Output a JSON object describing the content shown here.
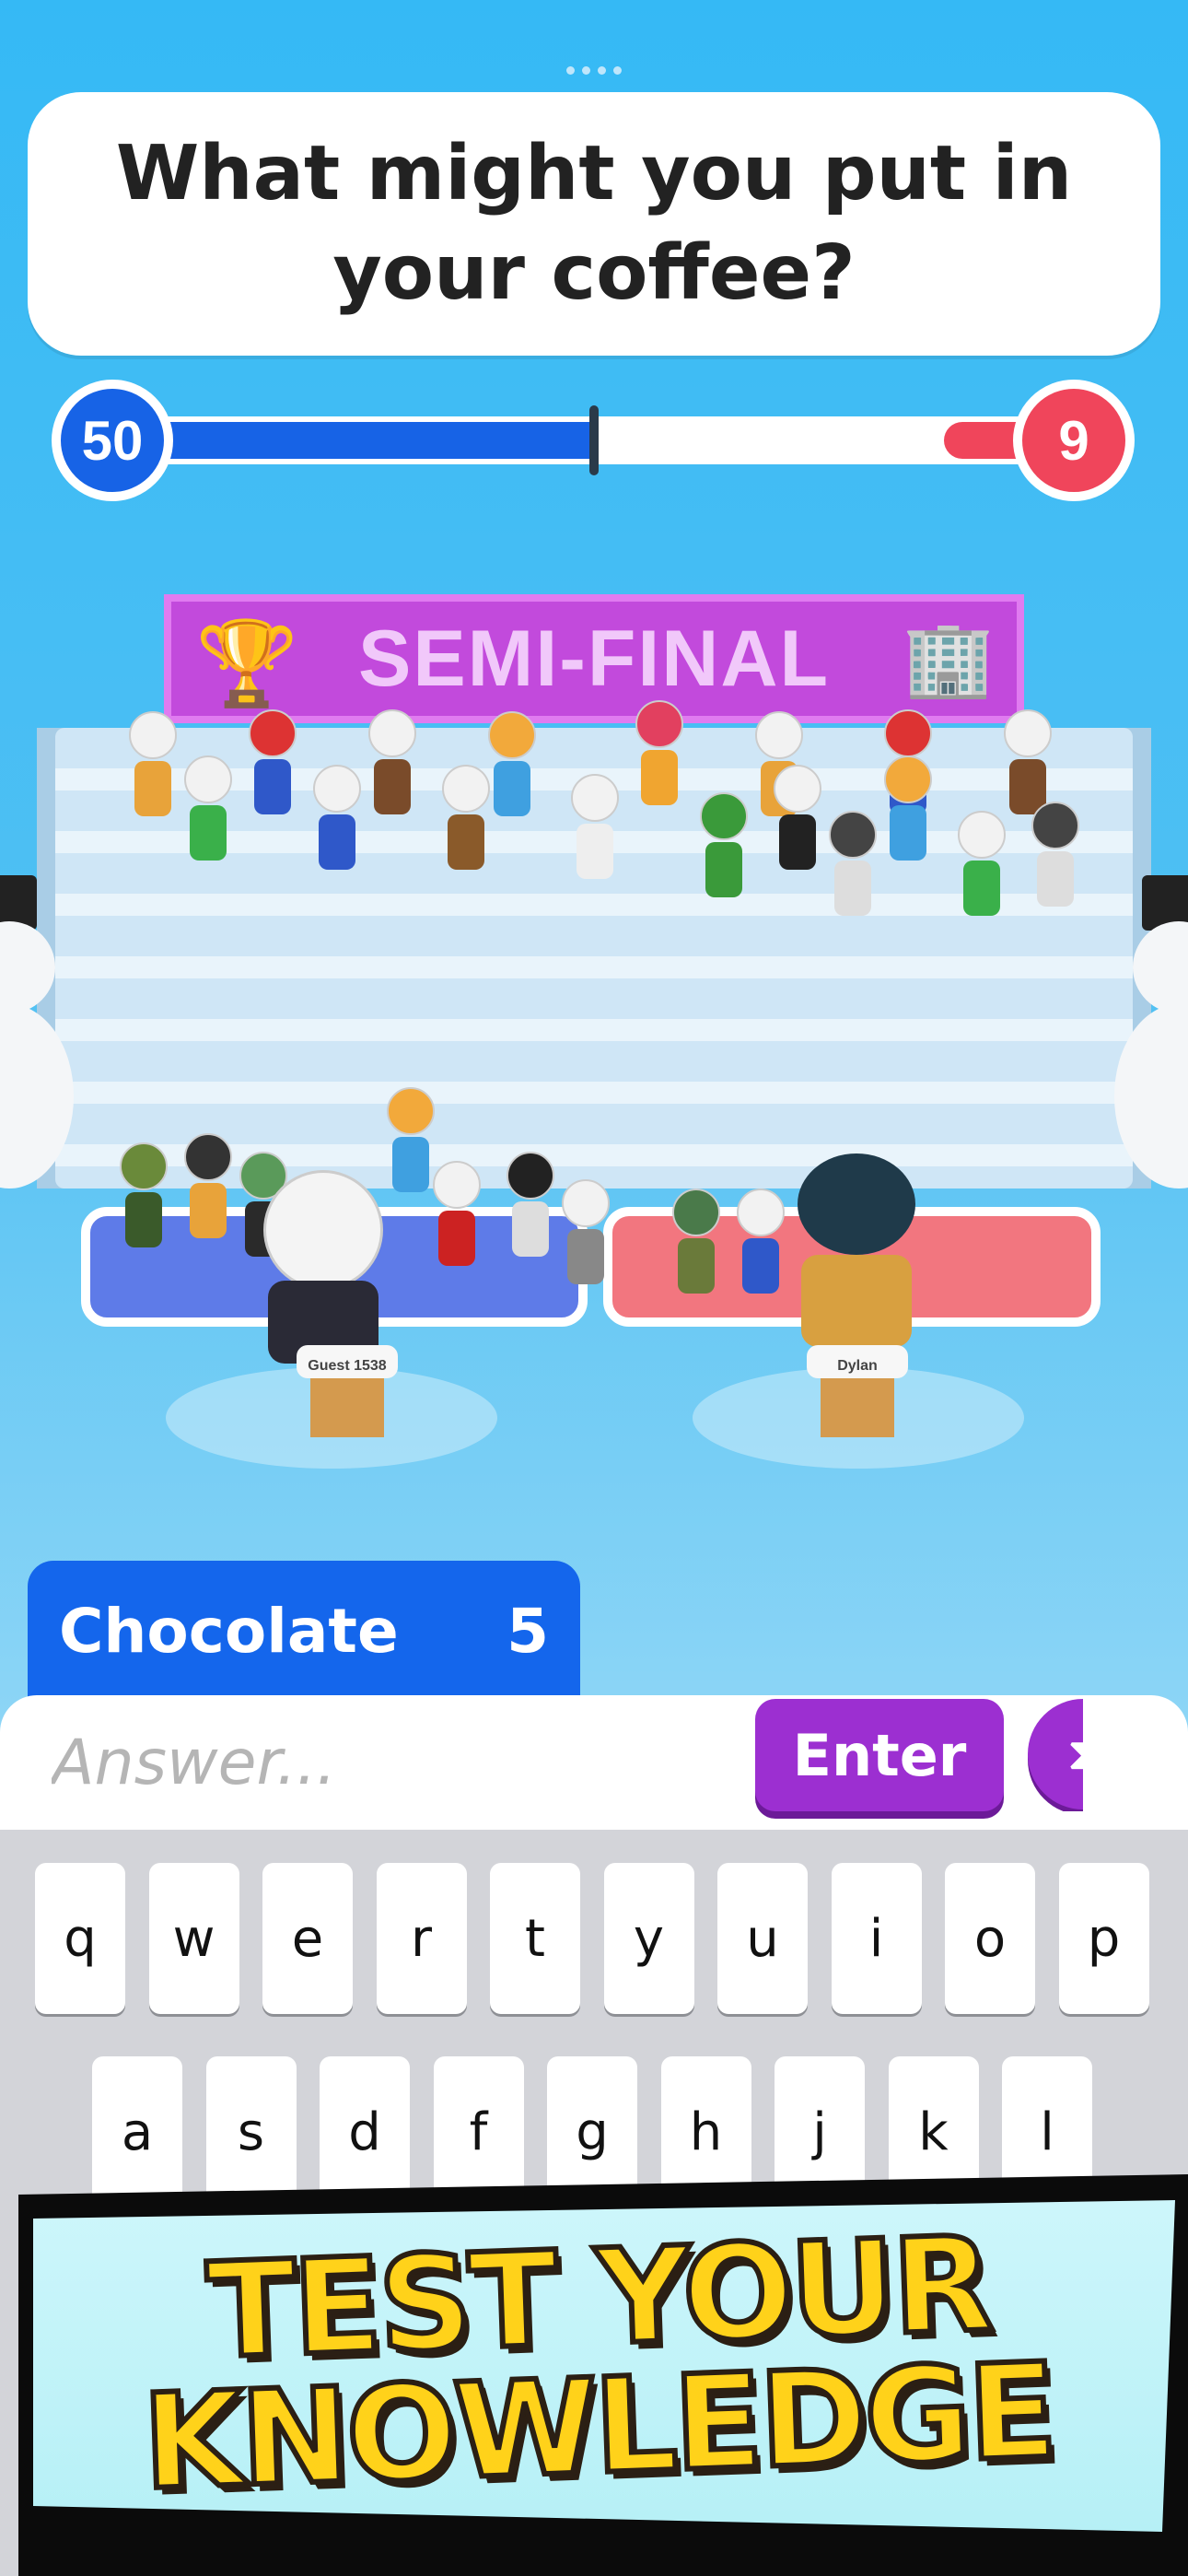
{
  "question": {
    "text": "What might you put in your coffee?"
  },
  "scores": {
    "left": "50",
    "right": "9",
    "left_color": "#1763e6",
    "right_color": "#f0455b"
  },
  "stage": {
    "banner": "SEMI-FINAL"
  },
  "players": {
    "left_name": "Guest 1538",
    "right_name": "Dylan"
  },
  "last_answer": {
    "word": "Chocolate",
    "points": "5"
  },
  "input": {
    "placeholder": "Answer...",
    "enter_label": "Enter",
    "hint_icon": "hourglass-icon"
  },
  "keyboard": {
    "row1": [
      "q",
      "w",
      "e",
      "r",
      "t",
      "y",
      "u",
      "i",
      "o",
      "p"
    ],
    "row2": [
      "a",
      "s",
      "d",
      "f",
      "g",
      "h",
      "j",
      "k",
      "l"
    ]
  },
  "promo": {
    "line1": "TEST YOUR",
    "line2": "KNOWLEDGE"
  }
}
